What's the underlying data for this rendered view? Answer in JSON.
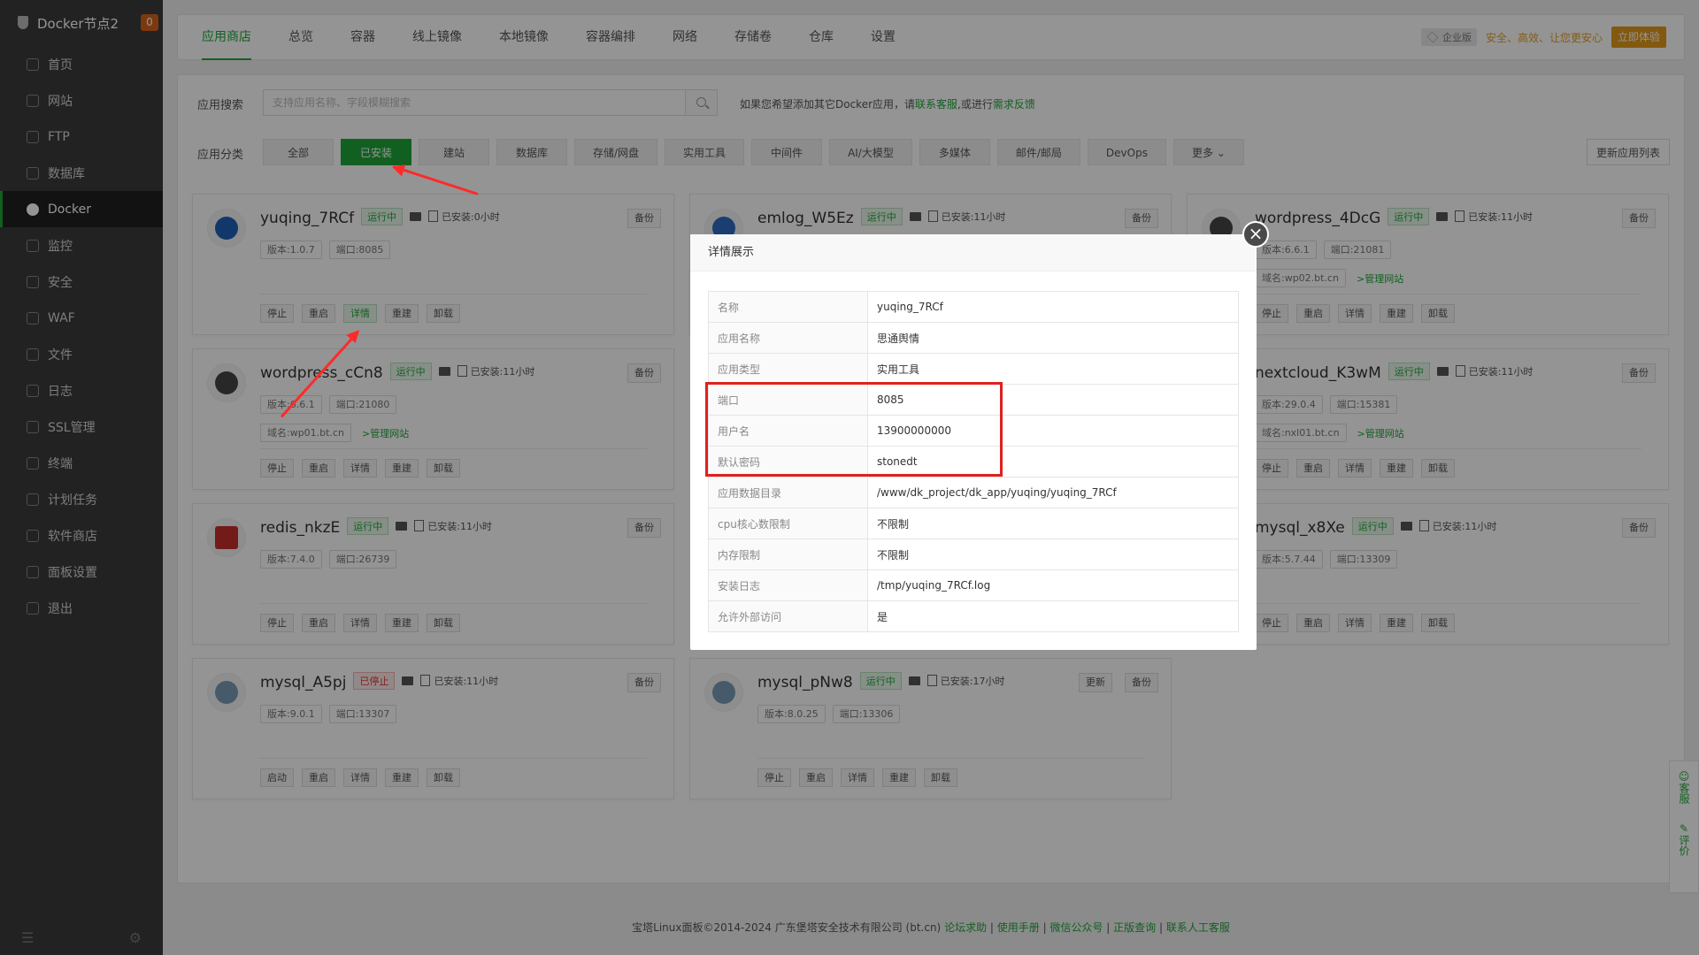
{
  "brand": {
    "title": "Docker节点2",
    "badge": "0"
  },
  "sidebar": {
    "items": [
      {
        "label": "首页"
      },
      {
        "label": "网站"
      },
      {
        "label": "FTP"
      },
      {
        "label": "数据库"
      },
      {
        "label": "Docker"
      },
      {
        "label": "监控"
      },
      {
        "label": "安全"
      },
      {
        "label": "WAF"
      },
      {
        "label": "文件"
      },
      {
        "label": "日志"
      },
      {
        "label": "SSL管理"
      },
      {
        "label": "终端"
      },
      {
        "label": "计划任务"
      },
      {
        "label": "软件商店"
      },
      {
        "label": "面板设置"
      },
      {
        "label": "退出"
      }
    ],
    "active": "Docker"
  },
  "tabs": [
    "应用商店",
    "总览",
    "容器",
    "线上镜像",
    "本地镜像",
    "容器编排",
    "网络",
    "存储卷",
    "仓库",
    "设置"
  ],
  "header_right": {
    "enterprise": "企业版",
    "tagline": "安全、高效、让您更安心",
    "try_label": "立即体验"
  },
  "search": {
    "label": "应用搜索",
    "placeholder": "支持应用名称、字段模糊搜索",
    "hint_prefix": "如果您希望添加其它Docker应用，请",
    "hint_link1": "联系客服",
    "hint_mid": ",或进行",
    "hint_link2": "需求反馈"
  },
  "categories": {
    "label": "应用分类",
    "items": [
      "全部",
      "已安装",
      "建站",
      "数据库",
      "存储/网盘",
      "实用工具",
      "中间件",
      "AI/大模型",
      "多媒体",
      "邮件/邮局",
      "DevOps",
      "更多"
    ],
    "refresh": "更新应用列表"
  },
  "cards": [
    {
      "name": "yuqing_7RCf",
      "status": "运行中",
      "installed": "已安装:0小时",
      "version": "版本:1.0.7",
      "port": "端口:8085",
      "actions": [
        "停止",
        "重启",
        "详情",
        "重建",
        "卸载"
      ],
      "backup": "备份"
    },
    {
      "name": "emlog_W5Ez",
      "status": "运行中",
      "installed": "已安装:11小时",
      "backup": "备份"
    },
    {
      "name": "wordpress_4DcG",
      "status": "运行中",
      "installed": "已安装:11小时",
      "version": "版本:6.6.1",
      "port": "端口:21081",
      "domain": "域名:wp02.bt.cn",
      "manage": ">管理网站",
      "actions": [
        "停止",
        "重启",
        "详情",
        "重建",
        "卸载"
      ],
      "backup": "备份"
    },
    {
      "name": "wordpress_cCn8",
      "status": "运行中",
      "installed": "已安装:11小时",
      "version": "版本:6.6.1",
      "port": "端口:21080",
      "domain": "域名:wp01.bt.cn",
      "manage": ">管理网站",
      "actions": [
        "停止",
        "重启",
        "详情",
        "重建",
        "卸载"
      ],
      "backup": "备份"
    },
    {
      "name": "nextcloud_K3wM",
      "status": "运行中",
      "installed": "已安装:11小时",
      "version": "版本:29.0.4",
      "port": "端口:15381",
      "domain": "域名:nxl01.bt.cn",
      "manage": ">管理网站",
      "actions": [
        "停止",
        "重启",
        "详情",
        "重建",
        "卸载"
      ],
      "backup": "备份"
    },
    {
      "name": "redis_nkzE",
      "status": "运行中",
      "installed": "已安装:11小时",
      "version": "版本:7.4.0",
      "port": "端口:26739",
      "actions": [
        "停止",
        "重启",
        "详情",
        "重建",
        "卸载"
      ],
      "backup": "备份"
    },
    {
      "name": "mysql_x8Xe",
      "status": "运行中",
      "installed": "已安装:11小时",
      "version": "版本:5.7.44",
      "port": "端口:13309",
      "actions": [
        "停止",
        "重启",
        "详情",
        "重建",
        "卸载"
      ],
      "backup": "备份"
    },
    {
      "name": "mysql_A5pj",
      "status": "已停止",
      "installed": "已安装:11小时",
      "version": "版本:9.0.1",
      "port": "端口:13307",
      "actions": [
        "启动",
        "重启",
        "详情",
        "重建",
        "卸载"
      ],
      "backup": "备份"
    },
    {
      "name": "mysql_pNw8",
      "status": "运行中",
      "installed": "已安装:17小时",
      "version": "版本:8.0.25",
      "port": "端口:13306",
      "actions": [
        "停止",
        "重启",
        "详情",
        "重建",
        "卸载"
      ],
      "backup": "备份",
      "update": "更新"
    }
  ],
  "modal": {
    "title": "详情展示",
    "rows": [
      {
        "k": "名称",
        "v": "yuqing_7RCf"
      },
      {
        "k": "应用名称",
        "v": "思通舆情"
      },
      {
        "k": "应用类型",
        "v": "实用工具"
      },
      {
        "k": "端口",
        "v": "8085"
      },
      {
        "k": "用户名",
        "v": "13900000000"
      },
      {
        "k": "默认密码",
        "v": "stonedt"
      },
      {
        "k": "应用数据目录",
        "v": "/www/dk_project/dk_app/yuqing/yuqing_7RCf"
      },
      {
        "k": "cpu核心数限制",
        "v": "不限制"
      },
      {
        "k": "内存限制",
        "v": "不限制"
      },
      {
        "k": "安装日志",
        "v": "/tmp/yuqing_7RCf.log"
      },
      {
        "k": "允许外部访问",
        "v": "是"
      }
    ]
  },
  "footer": {
    "copyright": "宝塔Linux面板©2014-2024 广东堡塔安全技术有限公司 (bt.cn)",
    "links": [
      "论坛求助",
      "使用手册",
      "微信公众号",
      "正版查询",
      "联系人工客服"
    ]
  },
  "float_side": {
    "service": "客服",
    "review": "评价"
  },
  "colors": {
    "accent": "#20a53a",
    "sidebar": "#3b3b3b",
    "warn": "#e09a19",
    "highlight": "#e02020"
  }
}
